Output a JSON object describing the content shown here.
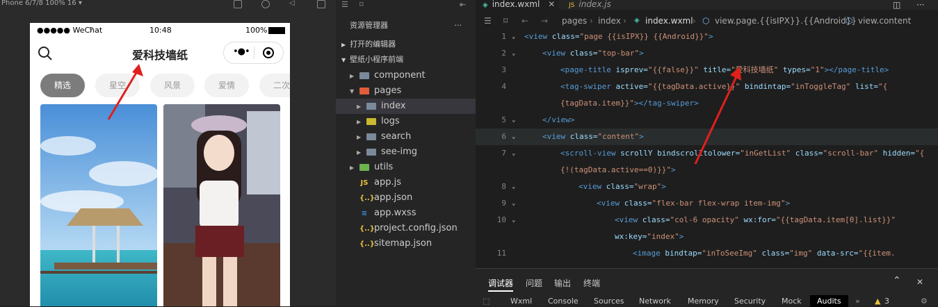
{
  "simulator": {
    "device_label": "Phone 6/7/8 100% 16 ▾",
    "status_left": "●●●●● WeChat",
    "status_time": "10:48",
    "status_battery": "100%",
    "page_title": "爱科技墙纸",
    "tags": [
      "精选",
      "星空",
      "风景",
      "爱情",
      "二次"
    ]
  },
  "explorer": {
    "title": "资源管理器",
    "more": "···",
    "open_editors": "打开的编辑器",
    "project": "壁纸小程序前端",
    "items": [
      {
        "label": "component",
        "kind": "folder",
        "depth": 1
      },
      {
        "label": "pages",
        "kind": "folder-open",
        "depth": 1
      },
      {
        "label": "index",
        "kind": "folder",
        "depth": 2
      },
      {
        "label": "logs",
        "kind": "folder",
        "depth": 2
      },
      {
        "label": "search",
        "kind": "folder",
        "depth": 2
      },
      {
        "label": "see-img",
        "kind": "folder",
        "depth": 2
      },
      {
        "label": "utils",
        "kind": "folder",
        "depth": 1
      },
      {
        "label": "app.js",
        "kind": "js",
        "depth": 1
      },
      {
        "label": "app.json",
        "kind": "json",
        "depth": 1
      },
      {
        "label": "app.wxss",
        "kind": "wxss",
        "depth": 1
      },
      {
        "label": "project.config.json",
        "kind": "json",
        "depth": 1
      },
      {
        "label": "sitemap.json",
        "kind": "json",
        "depth": 1
      }
    ]
  },
  "editor": {
    "tabs": [
      "index.wxml",
      "index.js"
    ],
    "breadcrumb": [
      "pages",
      "index",
      "index.wxml",
      "view.page.{{isIPX}}.{{Android}}",
      "view.content"
    ],
    "lines": [
      {
        "n": "1",
        "segs": [
          [
            "tag",
            "<view "
          ],
          [
            "attr",
            "class="
          ],
          [
            "str",
            "\"page {{isIPX}} {{Android}}\""
          ],
          [
            "tag",
            ">"
          ]
        ]
      },
      {
        "n": "2",
        "segs": [
          [
            "tag",
            "<view "
          ],
          [
            "attr",
            "class="
          ],
          [
            "str",
            "\"top-bar\""
          ],
          [
            "tag",
            ">"
          ]
        ]
      },
      {
        "n": "3",
        "segs": [
          [
            "tag",
            "<page-title "
          ],
          [
            "attr",
            "isprev="
          ],
          [
            "str",
            "\"{{false}}\""
          ],
          [
            "attr",
            " title="
          ],
          [
            "str",
            "\"爱科技墙纸\""
          ],
          [
            "attr",
            " types="
          ],
          [
            "str",
            "\"1\""
          ],
          [
            "tag",
            "></page-title>"
          ]
        ]
      },
      {
        "n": "4",
        "segs": [
          [
            "tag",
            "<tag-swiper "
          ],
          [
            "attr",
            "active="
          ],
          [
            "str",
            "\"{{tagData.active}}\""
          ],
          [
            "attr",
            " bindintap="
          ],
          [
            "str",
            "\"inToggleTag\""
          ],
          [
            "attr",
            " list="
          ],
          [
            "str",
            "\"{"
          ]
        ]
      },
      {
        "n": "",
        "segs": [
          [
            "str",
            "{tagData.item}}\""
          ],
          [
            "tag",
            "></tag-swiper>"
          ]
        ]
      },
      {
        "n": "5",
        "segs": [
          [
            "tag",
            "</view>"
          ]
        ]
      },
      {
        "n": "6",
        "segs": [
          [
            "tag",
            "<view "
          ],
          [
            "attr",
            "class="
          ],
          [
            "str",
            "\"content\""
          ],
          [
            "tag",
            ">"
          ]
        ]
      },
      {
        "n": "7",
        "segs": [
          [
            "tag",
            "<scroll-view "
          ],
          [
            "attr",
            "scrollY bindscrolltolower="
          ],
          [
            "str",
            "\"inGetList\""
          ],
          [
            "attr",
            " class="
          ],
          [
            "str",
            "\"scroll-bar\""
          ],
          [
            "attr",
            " hidden="
          ],
          [
            "str",
            "\"{"
          ]
        ]
      },
      {
        "n": "",
        "segs": [
          [
            "str",
            "{!(tagData.active==0)}}\""
          ],
          [
            "tag",
            ">"
          ]
        ]
      },
      {
        "n": "8",
        "segs": [
          [
            "tag",
            "<view "
          ],
          [
            "attr",
            "class="
          ],
          [
            "str",
            "\"wrap\""
          ],
          [
            "tag",
            ">"
          ]
        ]
      },
      {
        "n": "9",
        "segs": [
          [
            "tag",
            "<view "
          ],
          [
            "attr",
            "class="
          ],
          [
            "str",
            "\"flex-bar flex-wrap item-img\""
          ],
          [
            "tag",
            ">"
          ]
        ]
      },
      {
        "n": "10",
        "segs": [
          [
            "tag",
            "<view "
          ],
          [
            "attr",
            "class="
          ],
          [
            "str",
            "\"col-6 opacity\""
          ],
          [
            "attr",
            " wx:for="
          ],
          [
            "str",
            "\"{{tagData.item[0].list}}\""
          ]
        ]
      },
      {
        "n": "",
        "segs": [
          [
            "attr",
            "wx:key="
          ],
          [
            "str",
            "\"index\""
          ],
          [
            "tag",
            ">"
          ]
        ]
      },
      {
        "n": "11",
        "segs": [
          [
            "tag",
            "<image "
          ],
          [
            "attr",
            "bindtap="
          ],
          [
            "str",
            "\"inToSeeImg\""
          ],
          [
            "attr",
            " class="
          ],
          [
            "str",
            "\"img\""
          ],
          [
            "attr",
            " data-src="
          ],
          [
            "str",
            "\"{{item."
          ]
        ]
      }
    ]
  },
  "devtools": {
    "top_tabs": [
      "调试器",
      "问题",
      "输出",
      "终端"
    ],
    "panel_tabs": [
      "Wxml",
      "Console",
      "Sources",
      "Network",
      "Memory",
      "Security",
      "Mock",
      "Audits"
    ],
    "warning_count": "3"
  }
}
